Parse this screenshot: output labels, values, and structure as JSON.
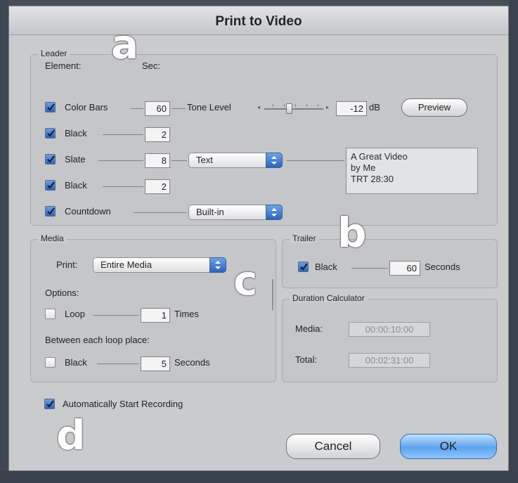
{
  "window": {
    "title": "Print to Video"
  },
  "leader": {
    "legend": "Leader",
    "element_header": "Element:",
    "sec_header": "Sec:",
    "rows": [
      {
        "label": "Color Bars",
        "checked": true,
        "seconds": "60"
      },
      {
        "label": "Black",
        "checked": true,
        "seconds": "2"
      },
      {
        "label": "Slate",
        "checked": true,
        "seconds": "8"
      },
      {
        "label": "Black",
        "checked": true,
        "seconds": "2"
      },
      {
        "label": "Countdown",
        "checked": true
      }
    ],
    "tone_level_label": "Tone Level",
    "tone_value": "-12",
    "tone_unit": "dB",
    "preview_label": "Preview",
    "slate_source": "Text",
    "slate_text": [
      "A Great Video",
      "by Me",
      "TRT 28:30"
    ],
    "countdown_source": "Built-in"
  },
  "media": {
    "legend": "Media",
    "print_label": "Print:",
    "print_value": "Entire Media",
    "options_label": "Options:",
    "loop_label": "Loop",
    "loop_checked": false,
    "loop_value": "1",
    "loop_unit": "Times",
    "between_label": "Between each loop place:",
    "black_label": "Black",
    "black_checked": false,
    "black_value": "5",
    "black_unit": "Seconds"
  },
  "trailer": {
    "legend": "Trailer",
    "black_label": "Black",
    "black_checked": true,
    "black_value": "60",
    "black_unit": "Seconds"
  },
  "duration": {
    "legend": "Duration Calculator",
    "media_label": "Media:",
    "media_value": "00:00:10:00",
    "total_label": "Total:",
    "total_value": "00:02:31:00"
  },
  "auto_start": {
    "label": "Automatically Start Recording",
    "checked": true
  },
  "buttons": {
    "cancel": "Cancel",
    "ok": "OK"
  },
  "annotations": {
    "a": "a",
    "b": "b",
    "c": "c",
    "d": "d"
  }
}
